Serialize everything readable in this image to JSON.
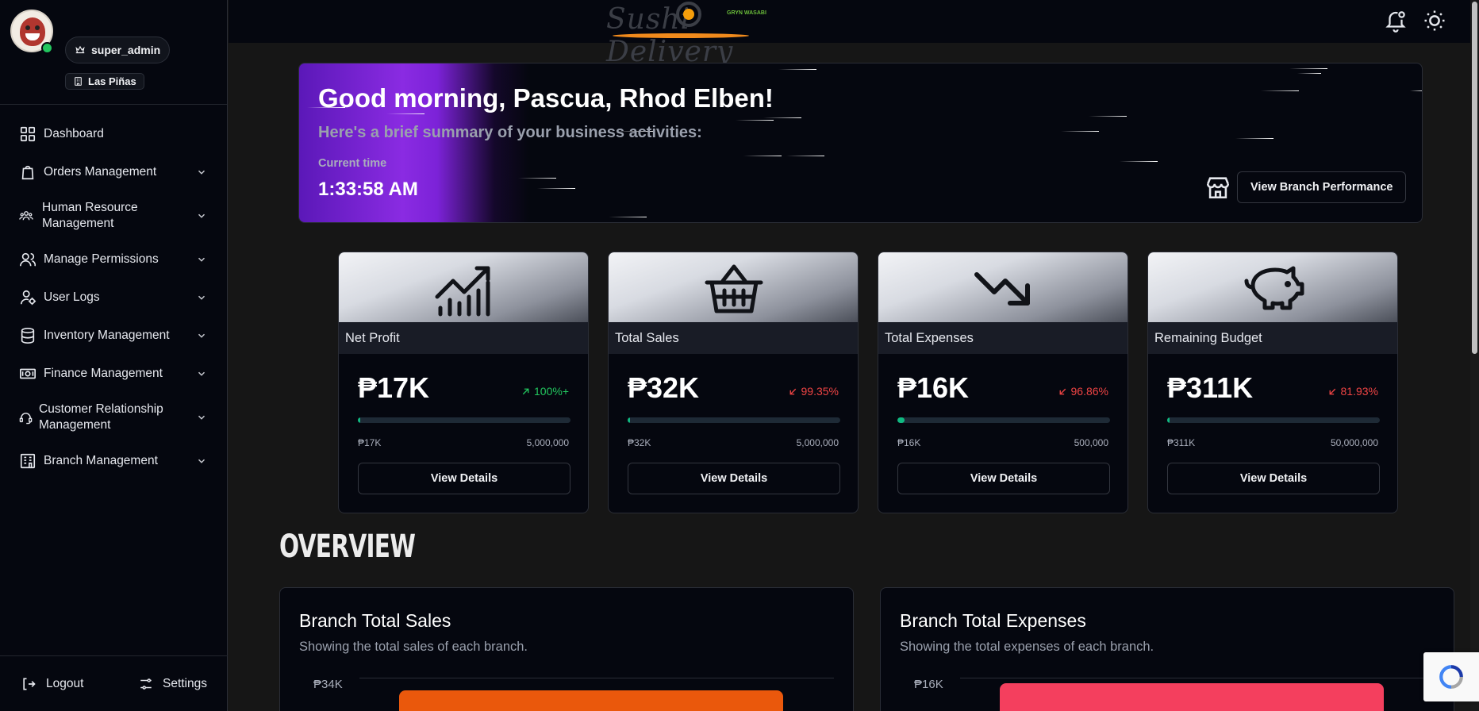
{
  "user": {
    "role": "super_admin",
    "branch": "Las Piñas"
  },
  "nav": [
    {
      "label": "Dashboard",
      "icon": "grid-icon",
      "expandable": false
    },
    {
      "label": "Orders Management",
      "icon": "shopping-bag-icon",
      "expandable": true
    },
    {
      "label": "Human Resource Management",
      "icon": "people-icon",
      "expandable": true
    },
    {
      "label": "Manage Permissions",
      "icon": "users-icon",
      "expandable": true
    },
    {
      "label": "User Logs",
      "icon": "user-cog-icon",
      "expandable": true
    },
    {
      "label": "Inventory Management",
      "icon": "database-icon",
      "expandable": true
    },
    {
      "label": "Finance Management",
      "icon": "banknote-icon",
      "expandable": true
    },
    {
      "label": "Customer Relationship Management",
      "icon": "headset-icon",
      "expandable": true
    },
    {
      "label": "Branch Management",
      "icon": "building-icon",
      "expandable": true
    }
  ],
  "footer": {
    "logout": "Logout",
    "settings": "Settings"
  },
  "topbar": {
    "logo_text": "Sushi Delivery",
    "logo_sub": "GRYN WASABI"
  },
  "hero": {
    "greeting": "Good morning, Pascua, Rhod Elben!",
    "subtitle": "Here's a brief summary of your business activities:",
    "time_label": "Current time",
    "time": "1:33:58 AM",
    "branch_button": "View Branch Performance"
  },
  "cards": [
    {
      "label": "Net Profit",
      "value": "₱17K",
      "change": "100%+",
      "direction": "up",
      "current": "₱17K",
      "target": "5,000,000",
      "progress": 0.0034,
      "icon": "trending-chart-icon",
      "button": "View Details"
    },
    {
      "label": "Total Sales",
      "value": "₱32K",
      "change": "99.35%",
      "direction": "down",
      "current": "₱32K",
      "target": "5,000,000",
      "progress": 0.0065,
      "icon": "basket-icon",
      "button": "View Details"
    },
    {
      "label": "Total Expenses",
      "value": "₱16K",
      "change": "96.86%",
      "direction": "down",
      "current": "₱16K",
      "target": "500,000",
      "progress": 0.032,
      "icon": "trending-down-icon",
      "button": "View Details"
    },
    {
      "label": "Remaining Budget",
      "value": "₱311K",
      "change": "81.93%",
      "direction": "down",
      "current": "₱311K",
      "target": "50,000,000",
      "progress": 0.0062,
      "icon": "piggy-bank-icon",
      "button": "View Details"
    }
  ],
  "overview_heading": "OVERVIEW",
  "panels": [
    {
      "title": "Branch Total Sales",
      "subtitle": "Showing the total sales of each branch.",
      "top_tick": "₱34K",
      "bar_color": "#ea580c"
    },
    {
      "title": "Branch Total Expenses",
      "subtitle": "Showing the total expenses of each branch.",
      "top_tick": "₱16K",
      "bar_color": "#f43f5e"
    }
  ],
  "colors": {
    "accent_purple": "#8a2be2",
    "up": "#22c55e",
    "down": "#ef4444",
    "progress": "#10b981"
  }
}
